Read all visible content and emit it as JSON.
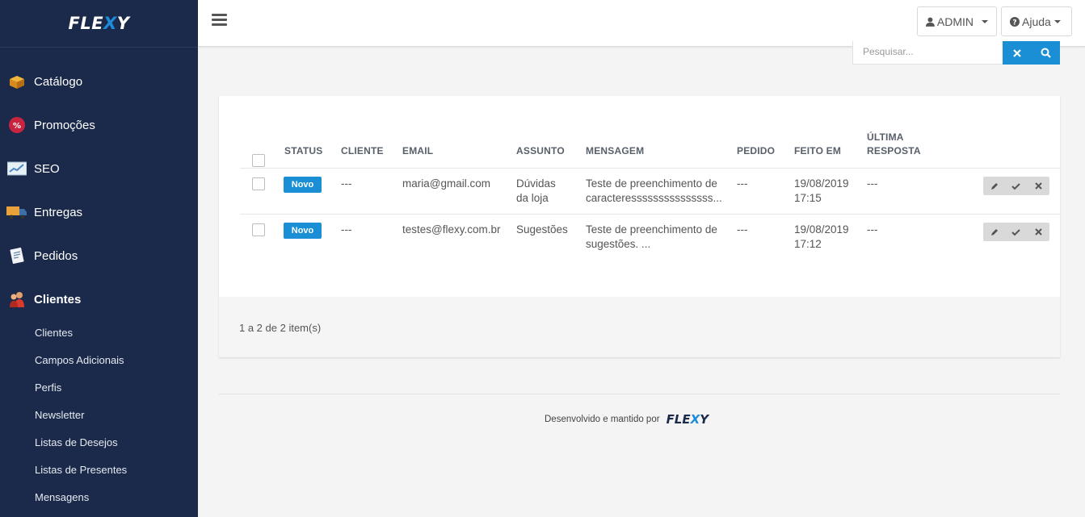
{
  "sidebar": {
    "logo": "FLEXY",
    "nav": [
      {
        "label": "Catálogo",
        "icon": "box-icon"
      },
      {
        "label": "Promoções",
        "icon": "percent-tag-icon"
      },
      {
        "label": "SEO",
        "icon": "seo-chart-icon"
      },
      {
        "label": "Entregas",
        "icon": "truck-icon"
      },
      {
        "label": "Pedidos",
        "icon": "clipboard-icon"
      },
      {
        "label": "Clientes",
        "icon": "users-icon",
        "active": true
      }
    ],
    "subitems": [
      "Clientes",
      "Campos Adicionais",
      "Perfis",
      "Newsletter",
      "Listas de Desejos",
      "Listas de Presentes",
      "Mensagens"
    ]
  },
  "topbar": {
    "admin_label": "ADMIN",
    "help_label": "Ajuda"
  },
  "search": {
    "placeholder": "Pesquisar..."
  },
  "table": {
    "headers": {
      "status": "STATUS",
      "cliente": "CLIENTE",
      "email": "EMAIL",
      "assunto": "ASSUNTO",
      "mensagem": "MENSAGEM",
      "pedido": "PEDIDO",
      "feito_em": "FEITO EM",
      "ultima_1": "ÚLTIMA",
      "ultima_2": "RESPOSTA"
    },
    "rows": [
      {
        "status": "Novo",
        "cliente": "---",
        "email": "maria@gmail.com",
        "assunto_1": "Dúvidas",
        "assunto_2": "da loja",
        "mensagem_1": "Teste de preenchimento de",
        "mensagem_2": "caracteresssssssssssssss...",
        "pedido": "---",
        "data": "19/08/2019",
        "hora": "17:15",
        "ultima": "---"
      },
      {
        "status": "Novo",
        "cliente": "---",
        "email": "testes@flexy.com.br",
        "assunto_1": "Sugestões",
        "assunto_2": "",
        "mensagem_1": "Teste de preenchimento de",
        "mensagem_2": "sugestões. ...",
        "pedido": "---",
        "data": "19/08/2019",
        "hora": "17:12",
        "ultima": "---"
      }
    ],
    "pagination": "1 a 2 de 2 item(s)"
  },
  "footer": {
    "text": "Desenvolvido e mantido por",
    "logo": "FLEXY"
  },
  "colors": {
    "sidebar_bg": "#1b2a4a",
    "accent": "#1a8fd6"
  }
}
